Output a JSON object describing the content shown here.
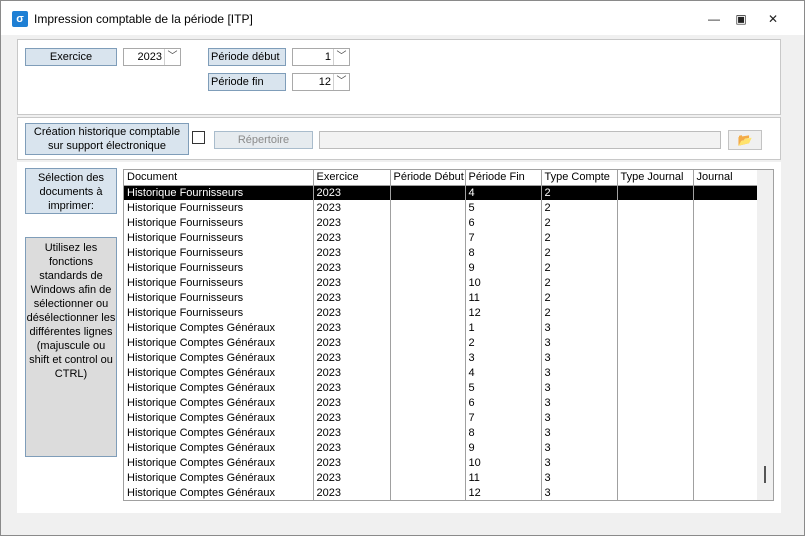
{
  "window": {
    "title": "Impression comptable de la période [ITP]",
    "minimize_glyph": "—",
    "maximize_glyph": "▣",
    "close_glyph": "✕"
  },
  "filters": {
    "exercice_label": "Exercice",
    "exercice_value": "2023",
    "periode_debut_label": "Période début",
    "periode_debut_value": "1",
    "periode_fin_label": "Période fin",
    "periode_fin_value": "12"
  },
  "archive": {
    "creation_label": "Création historique comptable sur support électronique",
    "checked": false,
    "repertoire_label": "Répertoire",
    "path_value": ""
  },
  "side": {
    "selection_label": "Sélection des documents à imprimer:",
    "help_text": "Utilisez les fonctions standards de Windows afin de sélectionner ou désélectionner les différentes lignes (majuscule ou shift et control ou CTRL)"
  },
  "grid": {
    "columns": [
      "Document",
      "Exercice",
      "Période Début",
      "Période Fin",
      "Type Compte",
      "Type Journal",
      "Journal"
    ],
    "rows": [
      {
        "document": "Historique Fournisseurs",
        "exercice": "2023",
        "debut": "",
        "fin": "4",
        "type_compte": "2",
        "type_journal": "",
        "journal": "",
        "selected": true
      },
      {
        "document": "Historique Fournisseurs",
        "exercice": "2023",
        "debut": "",
        "fin": "5",
        "type_compte": "2",
        "type_journal": "",
        "journal": ""
      },
      {
        "document": "Historique Fournisseurs",
        "exercice": "2023",
        "debut": "",
        "fin": "6",
        "type_compte": "2",
        "type_journal": "",
        "journal": ""
      },
      {
        "document": "Historique Fournisseurs",
        "exercice": "2023",
        "debut": "",
        "fin": "7",
        "type_compte": "2",
        "type_journal": "",
        "journal": ""
      },
      {
        "document": "Historique Fournisseurs",
        "exercice": "2023",
        "debut": "",
        "fin": "8",
        "type_compte": "2",
        "type_journal": "",
        "journal": ""
      },
      {
        "document": "Historique Fournisseurs",
        "exercice": "2023",
        "debut": "",
        "fin": "9",
        "type_compte": "2",
        "type_journal": "",
        "journal": ""
      },
      {
        "document": "Historique Fournisseurs",
        "exercice": "2023",
        "debut": "",
        "fin": "10",
        "type_compte": "2",
        "type_journal": "",
        "journal": ""
      },
      {
        "document": "Historique Fournisseurs",
        "exercice": "2023",
        "debut": "",
        "fin": "11",
        "type_compte": "2",
        "type_journal": "",
        "journal": ""
      },
      {
        "document": "Historique Fournisseurs",
        "exercice": "2023",
        "debut": "",
        "fin": "12",
        "type_compte": "2",
        "type_journal": "",
        "journal": ""
      },
      {
        "document": "Historique Comptes Généraux",
        "exercice": "2023",
        "debut": "",
        "fin": "1",
        "type_compte": "3",
        "type_journal": "",
        "journal": ""
      },
      {
        "document": "Historique Comptes Généraux",
        "exercice": "2023",
        "debut": "",
        "fin": "2",
        "type_compte": "3",
        "type_journal": "",
        "journal": ""
      },
      {
        "document": "Historique Comptes Généraux",
        "exercice": "2023",
        "debut": "",
        "fin": "3",
        "type_compte": "3",
        "type_journal": "",
        "journal": ""
      },
      {
        "document": "Historique Comptes Généraux",
        "exercice": "2023",
        "debut": "",
        "fin": "4",
        "type_compte": "3",
        "type_journal": "",
        "journal": ""
      },
      {
        "document": "Historique Comptes Généraux",
        "exercice": "2023",
        "debut": "",
        "fin": "5",
        "type_compte": "3",
        "type_journal": "",
        "journal": ""
      },
      {
        "document": "Historique Comptes Généraux",
        "exercice": "2023",
        "debut": "",
        "fin": "6",
        "type_compte": "3",
        "type_journal": "",
        "journal": ""
      },
      {
        "document": "Historique Comptes Généraux",
        "exercice": "2023",
        "debut": "",
        "fin": "7",
        "type_compte": "3",
        "type_journal": "",
        "journal": ""
      },
      {
        "document": "Historique Comptes Généraux",
        "exercice": "2023",
        "debut": "",
        "fin": "8",
        "type_compte": "3",
        "type_journal": "",
        "journal": ""
      },
      {
        "document": "Historique Comptes Généraux",
        "exercice": "2023",
        "debut": "",
        "fin": "9",
        "type_compte": "3",
        "type_journal": "",
        "journal": ""
      },
      {
        "document": "Historique Comptes Généraux",
        "exercice": "2023",
        "debut": "",
        "fin": "10",
        "type_compte": "3",
        "type_journal": "",
        "journal": ""
      },
      {
        "document": "Historique Comptes Généraux",
        "exercice": "2023",
        "debut": "",
        "fin": "11",
        "type_compte": "3",
        "type_journal": "",
        "journal": ""
      },
      {
        "document": "Historique Comptes Généraux",
        "exercice": "2023",
        "debut": "",
        "fin": "12",
        "type_compte": "3",
        "type_journal": "",
        "journal": ""
      }
    ]
  }
}
